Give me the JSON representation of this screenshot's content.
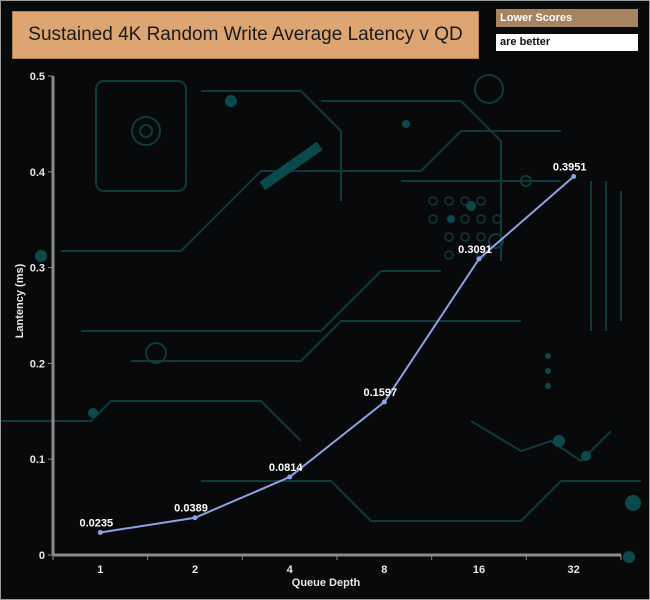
{
  "chart_data": {
    "type": "line",
    "title": "Sustained 4K Random Write Average Latency v QD",
    "xlabel": "Queue Depth",
    "ylabel": "Lantency (ms)",
    "categories": [
      "1",
      "2",
      "4",
      "8",
      "16",
      "32"
    ],
    "series": [
      {
        "values": [
          0.0235,
          0.0389,
          0.0814,
          0.1597,
          0.3091,
          0.3951
        ],
        "color": "#8ea3e6"
      }
    ],
    "data_labels": [
      "0.0235",
      "0.0389",
      "0.0814",
      "0.1597",
      "0.3091",
      "0.3951"
    ],
    "yticks": [
      "0",
      "0.1",
      "0.2",
      "0.3",
      "0.4",
      "0.5"
    ],
    "ylim": [
      0,
      0.5
    ],
    "grid": false,
    "legend_notes": [
      "Lower Scores",
      "are better"
    ]
  }
}
